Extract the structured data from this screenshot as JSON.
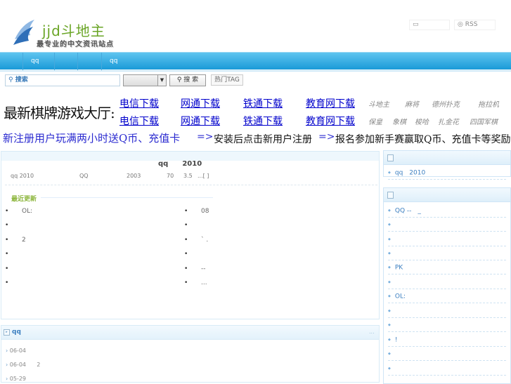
{
  "header": {
    "logo_text": "jjd斗地主",
    "logo_sub": "最专业的中文资讯站点",
    "top_links": [
      {
        "icon": "folder-icon",
        "label": ""
      },
      {
        "icon": "rss-icon",
        "label": "RSS"
      }
    ]
  },
  "nav": {
    "items": [
      "qq",
      "",
      "",
      "qq"
    ]
  },
  "search": {
    "placeholder": "搜索",
    "select_value": "",
    "button": "搜 索",
    "hot_tag": "热门TAG"
  },
  "banner": {
    "hall_title": "最新棋牌游戏大厅:",
    "downloads_row1": [
      "电信下载",
      "网通下载",
      "铁通下载",
      "教育网下载"
    ],
    "downloads_row2": [
      "电信下载",
      "网通下载",
      "铁通下载",
      "教育网下载"
    ],
    "games_row1": [
      "斗地主",
      "麻将",
      "德州扑克",
      "拖拉机"
    ],
    "games_row2": [
      "保皇",
      "象棋",
      "梭哈",
      "扎金花",
      "四国军棋"
    ],
    "promo": {
      "step1": "新注册用户玩满两小时送Q币、充值卡",
      "arrow": "=>",
      "step2": "安装后点击新用户注册",
      "step3": "报名参加新手赛赢取Q币、充值卡等奖励"
    }
  },
  "article": {
    "title": "qq　　2010",
    "summary": [
      "qq 2010",
      "QQ",
      "2003",
      "70",
      "3.5",
      "...[ ]"
    ],
    "recent_label": "最近更新",
    "left_items": [
      "OL:",
      "",
      "2",
      "",
      "",
      ""
    ],
    "right_items": [
      "08",
      "",
      "` .",
      "",
      "--",
      "..."
    ]
  },
  "list_box": {
    "title": "qq",
    "more": "...",
    "items": [
      {
        "date": "06-04",
        "text": ""
      },
      {
        "date": "06-04",
        "text": "2"
      },
      {
        "date": "05-29",
        "text": ""
      }
    ]
  },
  "sidebar": {
    "box1": {
      "items": [
        "qq　2010"
      ]
    },
    "box2": {
      "items": [
        "QQ --　_",
        "",
        "",
        "",
        "PK",
        "",
        "OL:",
        "",
        "",
        "!",
        "",
        ""
      ]
    }
  }
}
